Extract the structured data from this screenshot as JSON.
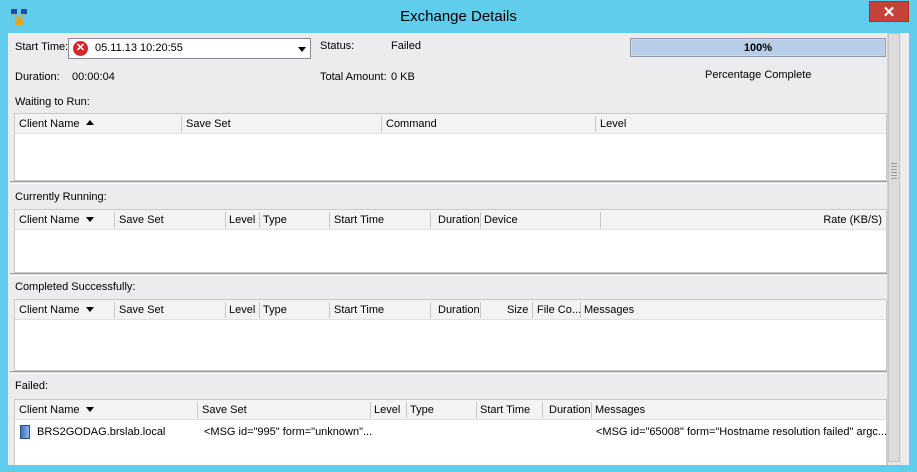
{
  "window": {
    "title": "Exchange Details",
    "close_label": "✕"
  },
  "summary": {
    "start_time_label": "Start Time:",
    "start_time_value": "05.11.13 10:20:55",
    "status_label": "Status:",
    "status_value": "Failed",
    "duration_label": "Duration:",
    "duration_value": "00:00:04",
    "total_amount_label": "Total Amount:",
    "total_amount_value": "0 KB",
    "progress_text": "100%",
    "progress_fraction": 1.0,
    "progress_caption": "Percentage Complete"
  },
  "waiting": {
    "label": "Waiting to Run:",
    "columns": [
      "Client Name",
      "Save Set",
      "Command",
      "Level"
    ]
  },
  "running": {
    "label": "Currently Running:",
    "columns": [
      "Client Name",
      "Save Set",
      "Level",
      "Type",
      "Start Time",
      "Duration",
      "Device",
      "Rate (KB/S)"
    ]
  },
  "completed": {
    "label": "Completed Successfully:",
    "columns": [
      "Client Name",
      "Save Set",
      "Level",
      "Type",
      "Start Time",
      "Duration",
      "Size",
      "File Co...",
      "Messages"
    ]
  },
  "failed": {
    "label": "Failed:",
    "columns": [
      "Client Name",
      "Save Set",
      "Level",
      "Type",
      "Start Time",
      "Duration",
      "Messages"
    ],
    "rows": [
      {
        "client": "BRS2GODAG.brslab.local",
        "save_set": "<MSG id=\"995\" form=\"unknown\"...",
        "messages": "<MSG id=\"65008\" form=\"Hostname resolution failed\" argc..."
      }
    ]
  },
  "colors": {
    "titlebar": "#5fcdeb",
    "close": "#c7423b",
    "error_icon": "#d9262b",
    "progress": "#b8cde6"
  }
}
